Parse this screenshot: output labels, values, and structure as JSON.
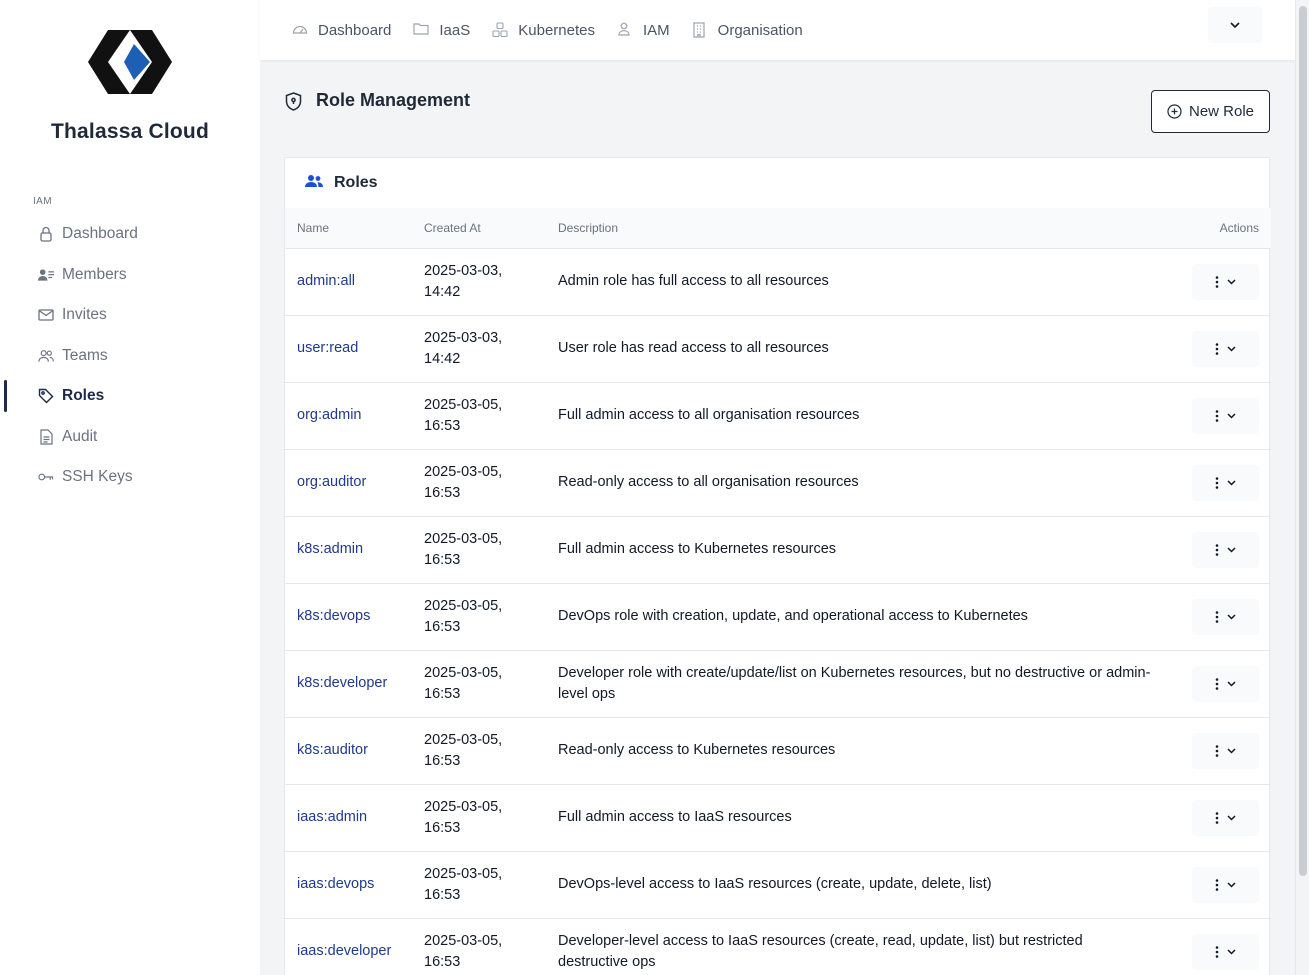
{
  "brand": {
    "name": "Thalassa Cloud",
    "colors": {
      "dark": "#111111",
      "accent": "#1d5fb4"
    }
  },
  "sidebar": {
    "section_label": "IAM",
    "items": [
      {
        "label": "Dashboard",
        "icon": "lock-icon"
      },
      {
        "label": "Members",
        "icon": "members-icon"
      },
      {
        "label": "Invites",
        "icon": "envelope-icon"
      },
      {
        "label": "Teams",
        "icon": "users-icon"
      },
      {
        "label": "Roles",
        "icon": "tag-icon",
        "active": true
      },
      {
        "label": "Audit",
        "icon": "document-icon"
      },
      {
        "label": "SSH Keys",
        "icon": "key-icon"
      }
    ]
  },
  "topnav": {
    "items": [
      {
        "label": "Dashboard",
        "icon": "gauge-icon"
      },
      {
        "label": "IaaS",
        "icon": "folder-icon"
      },
      {
        "label": "Kubernetes",
        "icon": "cubes-icon"
      },
      {
        "label": "IAM",
        "icon": "user-icon"
      },
      {
        "label": "Organisation",
        "icon": "building-icon"
      }
    ]
  },
  "page": {
    "title": "Role Management",
    "new_role_label": "New Role",
    "card_title": "Roles"
  },
  "table": {
    "headers": {
      "name": "Name",
      "created": "Created At",
      "description": "Description",
      "actions": "Actions"
    },
    "rows": [
      {
        "name": "admin:all",
        "created_date": "2025-03-03,",
        "created_time": "14:42",
        "description": "Admin role has full access to all resources"
      },
      {
        "name": "user:read",
        "created_date": "2025-03-03,",
        "created_time": "14:42",
        "description": "User role has read access to all resources"
      },
      {
        "name": "org:admin",
        "created_date": "2025-03-05,",
        "created_time": "16:53",
        "description": "Full admin access to all organisation resources"
      },
      {
        "name": "org:auditor",
        "created_date": "2025-03-05,",
        "created_time": "16:53",
        "description": "Read-only access to all organisation resources"
      },
      {
        "name": "k8s:admin",
        "created_date": "2025-03-05,",
        "created_time": "16:53",
        "description": "Full admin access to Kubernetes resources"
      },
      {
        "name": "k8s:devops",
        "created_date": "2025-03-05,",
        "created_time": "16:53",
        "description": "DevOps role with creation, update, and operational access to Kubernetes"
      },
      {
        "name": "k8s:developer",
        "created_date": "2025-03-05,",
        "created_time": "16:53",
        "description": "Developer role with create/update/list on Kubernetes resources, but no destructive or admin-level ops"
      },
      {
        "name": "k8s:auditor",
        "created_date": "2025-03-05,",
        "created_time": "16:53",
        "description": "Read-only access to Kubernetes resources"
      },
      {
        "name": "iaas:admin",
        "created_date": "2025-03-05,",
        "created_time": "16:53",
        "description": "Full admin access to IaaS resources"
      },
      {
        "name": "iaas:devops",
        "created_date": "2025-03-05,",
        "created_time": "16:53",
        "description": "DevOps-level access to IaaS resources (create, update, delete, list)"
      },
      {
        "name": "iaas:developer",
        "created_date": "2025-03-05,",
        "created_time": "16:53",
        "description": "Developer-level access to IaaS resources (create, read, update, list) but restricted destructive ops"
      }
    ]
  }
}
